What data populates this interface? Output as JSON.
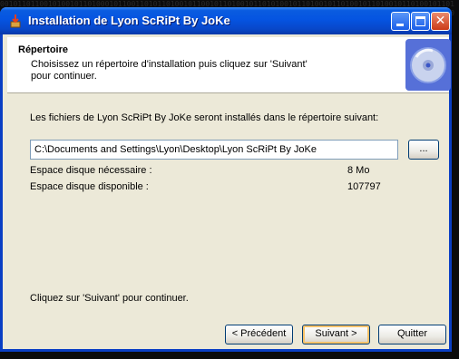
{
  "window": {
    "title": "Installation de Lyon ScRiPt By JoKe"
  },
  "header": {
    "title": "Répertoire",
    "description_line1": "Choisissez un répertoire d'installation puis cliquez sur 'Suivant'",
    "description_line2": "pour continuer."
  },
  "main": {
    "intro": "Les fichiers de Lyon ScRiPt By JoKe seront installés dans le répertoire suivant:",
    "install_path": "C:\\Documents and Settings\\Lyon\\Desktop\\Lyon ScRiPt By JoKe",
    "browse_label": "...",
    "space_required_label": "Espace disque nécessaire :",
    "space_required_value": "8 Mo",
    "space_available_label": "Espace disque disponible :",
    "space_available_value": "107797",
    "footer_hint": "Cliquez sur 'Suivant' pour continuer."
  },
  "buttons": {
    "previous": "< Précédent",
    "next": "Suivant >",
    "quit": "Quitter"
  },
  "icons": {
    "title_icon": "installer-icon",
    "header_logo": "cd-disc-icon"
  },
  "colors": {
    "titlebar": "#0554e1",
    "window_bg": "#ece9d8",
    "close_button": "#cc3b18"
  }
}
